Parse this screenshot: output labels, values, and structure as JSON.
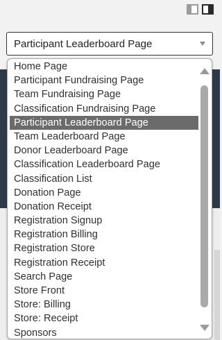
{
  "colors": {
    "selected_bg": "#6b6b6b",
    "selected_text": "#ffffff",
    "option_text": "#303030",
    "header_dark": "#2e3a4a"
  },
  "icons": {
    "layout_toggle": [
      "layout-sidebar-left-icon",
      "layout-sidebar-right-icon"
    ],
    "select_arrow": "chevron-down-icon",
    "scroll_up": "scroll-up-arrow-icon",
    "scroll_down": "scroll-down-arrow-icon"
  },
  "select": {
    "value": "Participant Leaderboard Page"
  },
  "dropdown": {
    "selected_index": 4,
    "options": [
      "Home Page",
      "Participant Fundraising Page",
      "Team Fundraising Page",
      "Classification Fundraising Page",
      "Participant Leaderboard Page",
      "Team Leaderboard Page",
      "Donor Leaderboard Page",
      "Classification Leaderboard Page",
      "Classification List",
      "Donation Page",
      "Donation Receipt",
      "Registration Signup",
      "Registration Billing",
      "Registration Store",
      "Registration Receipt",
      "Search Page",
      "Store Front",
      "Store: Billing",
      "Store: Receipt",
      "Sponsors"
    ]
  }
}
